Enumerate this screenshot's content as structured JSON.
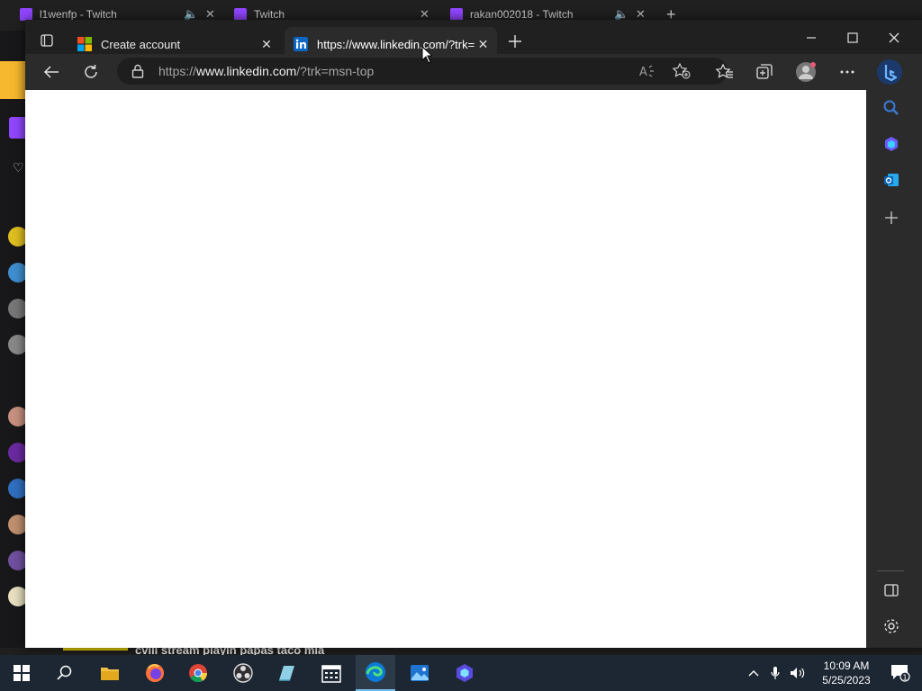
{
  "background_window": {
    "tabs": [
      {
        "title": "l1wenfp - Twitch"
      },
      {
        "title": "Twitch"
      },
      {
        "title": "rakan002018 - Twitch"
      }
    ],
    "bottom_text": "cvlli stream playin papas taco mia"
  },
  "browser": {
    "tabs": [
      {
        "title": "Create account",
        "favicon": "microsoft-logo-icon",
        "active": false
      },
      {
        "title": "https://www.linkedin.com/?trk=msn-top",
        "favicon": "linkedin-logo-icon",
        "active": true
      }
    ],
    "address_bar": {
      "prefix": "https://",
      "host": "www.linkedin.com",
      "path": "/?trk=msn-top"
    },
    "toolbar_icons": [
      "back-icon",
      "refresh-icon",
      "lock-icon",
      "read-aloud-icon",
      "add-favorite-icon",
      "favorites-icon",
      "collections-icon",
      "profile-avatar",
      "more-icon",
      "bing-chat-icon"
    ],
    "sidebar_icons": [
      "search-icon",
      "copilot-icon",
      "outlook-icon",
      "add-icon",
      "hide-sidebar-icon",
      "settings-icon"
    ],
    "page_content": ""
  },
  "taskbar": {
    "apps": [
      "start-icon",
      "search-icon",
      "file-explorer-icon",
      "firefox-icon",
      "chrome-icon",
      "obs-icon",
      "notepad-icon",
      "calendar-icon",
      "edge-icon",
      "photos-icon",
      "bing-icon"
    ],
    "clock_time": "10:09 AM",
    "clock_date": "5/25/2023",
    "notification_count": "1"
  },
  "colors": {
    "accent": "#76b9ed",
    "twitch": "#9146ff",
    "linkedin": "#0a66c2",
    "content_bg": "#ffffff",
    "chrome_bg": "#2b2b2b"
  }
}
